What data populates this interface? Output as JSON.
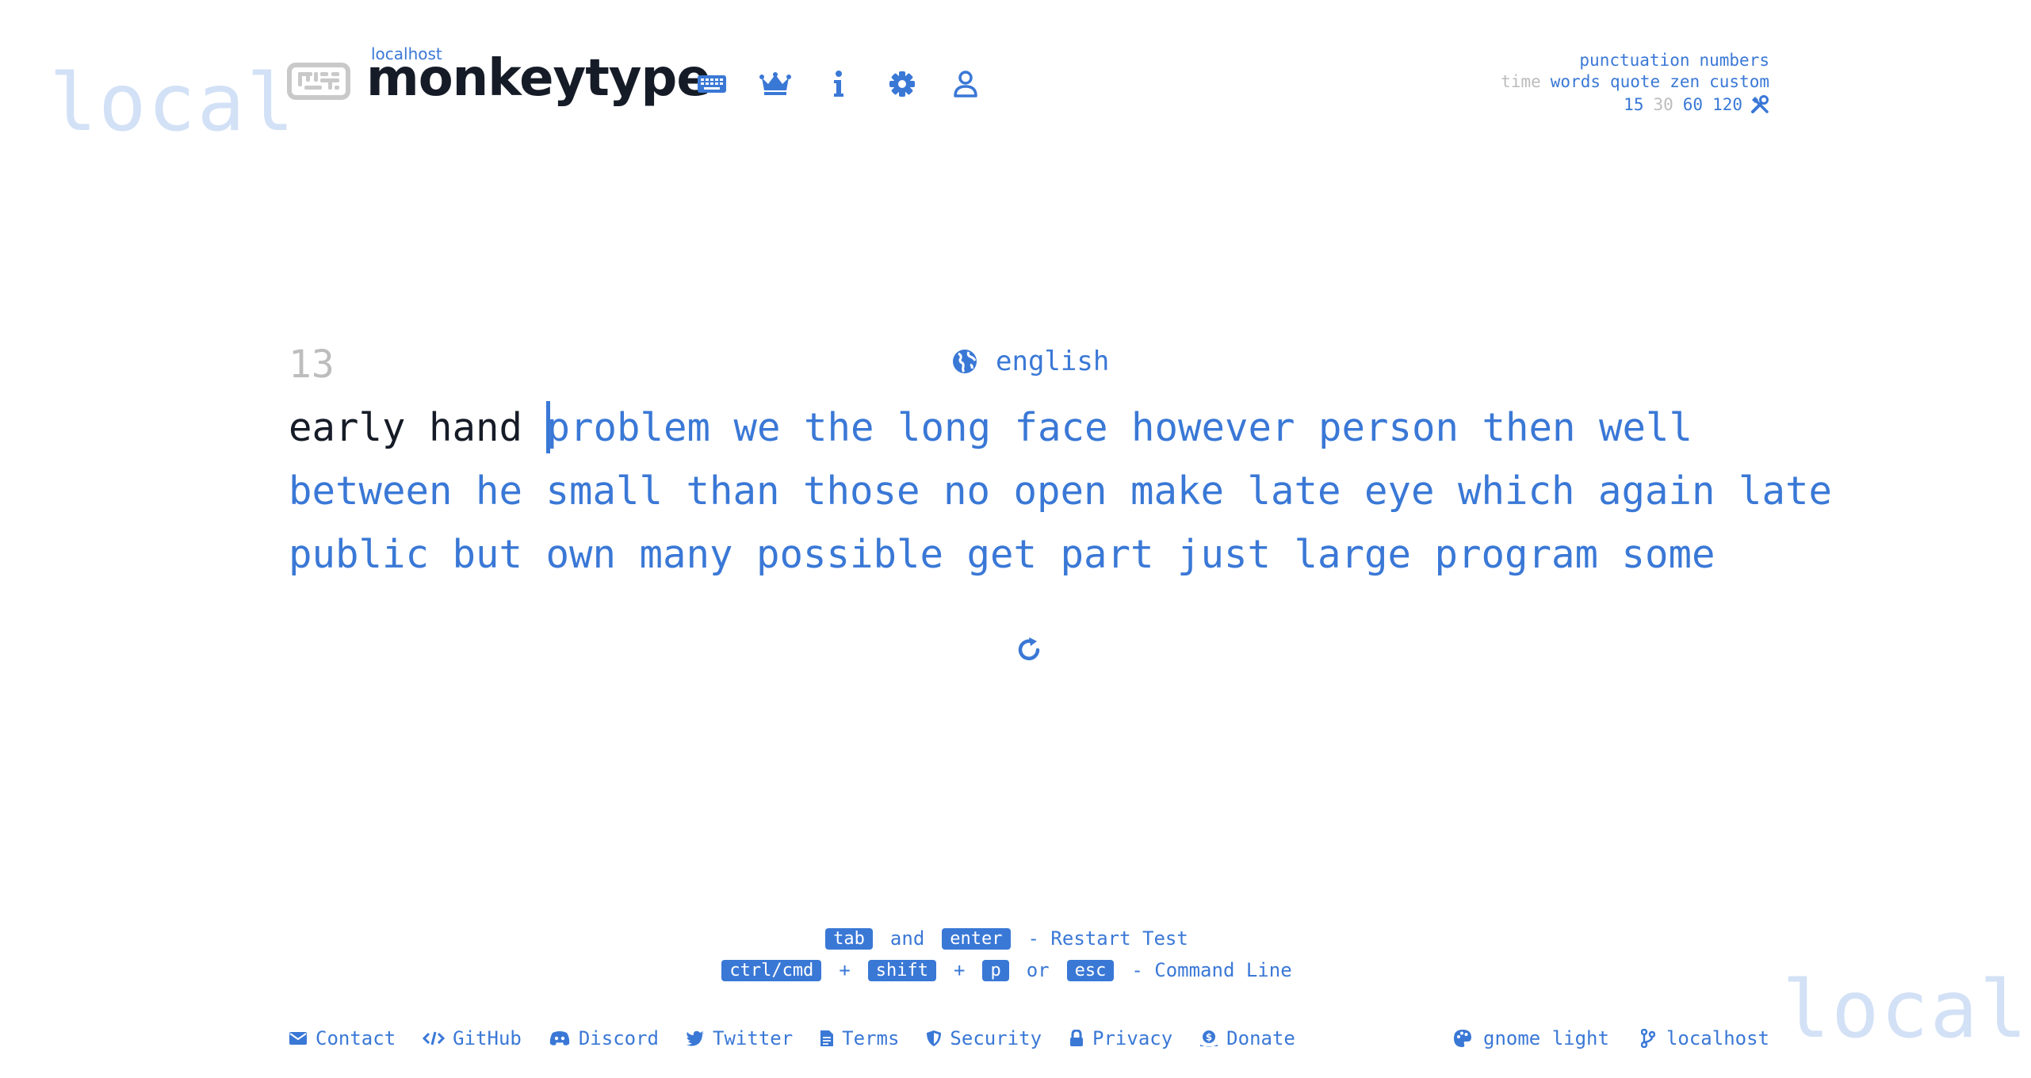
{
  "watermark": {
    "top_left": "local",
    "bottom_right": "local"
  },
  "header": {
    "brand_sub": "localhost",
    "brand": "monkeytype",
    "nav_icons": [
      "keyboard-icon",
      "crown-icon",
      "info-icon",
      "gear-icon",
      "user-icon"
    ]
  },
  "config": {
    "row1": [
      "punctuation",
      "numbers"
    ],
    "row2": [
      "time",
      "words",
      "quote",
      "zen",
      "custom"
    ],
    "row3": [
      "15",
      "30",
      "60",
      "120"
    ]
  },
  "test": {
    "timer": "13",
    "language": "english",
    "typed": "early hand ",
    "line1": "problem we the long face however person then well",
    "line2": "between he small than those no open make late eye which again late",
    "line3": "public but own many possible get part just large program some"
  },
  "hints": {
    "row1": {
      "key1": "tab",
      "word1": "and",
      "key2": "enter",
      "action": "- Restart Test"
    },
    "row2": {
      "key1": "ctrl/cmd",
      "plus1": "+",
      "key2": "shift",
      "plus2": "+",
      "key3": "p",
      "word": "or",
      "key4": "esc",
      "action": "- Command Line"
    }
  },
  "footer": {
    "links": [
      "Contact",
      "GitHub",
      "Discord",
      "Twitter",
      "Terms",
      "Security",
      "Privacy",
      "Donate"
    ],
    "theme": "gnome light",
    "version": "localhost"
  },
  "colors": {
    "main": "#3a78d6",
    "text": "#161c27",
    "sub": "#bdbdbd",
    "background": "#ffffff"
  }
}
